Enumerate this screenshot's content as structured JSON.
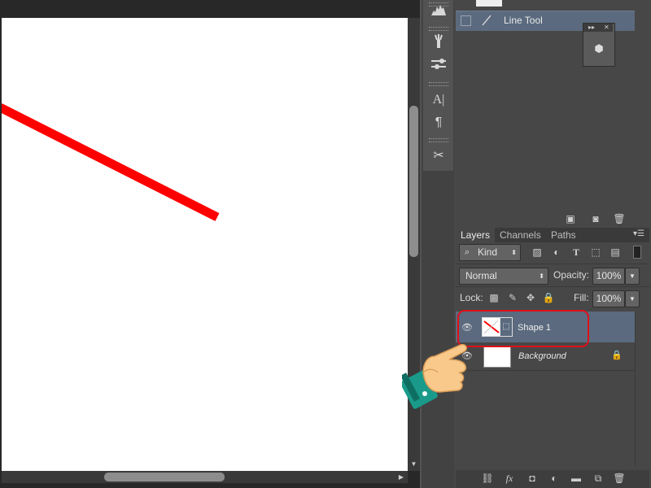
{
  "history": {
    "item_label": "Line Tool"
  },
  "layers_panel": {
    "tabs": [
      "Layers",
      "Channels",
      "Paths"
    ],
    "filter": {
      "kind_label": "Kind"
    },
    "blend_mode": "Normal",
    "opacity_label": "Opacity:",
    "opacity_value": "100%",
    "lock_label": "Lock:",
    "fill_label": "Fill:",
    "fill_value": "100%",
    "layers": [
      {
        "name": "Shape 1",
        "selected": true
      },
      {
        "name": "Background",
        "selected": false,
        "locked": true
      }
    ]
  },
  "colors": {
    "selection_blue": "#5b6a7e",
    "annotation_red": "#e0101a",
    "line_red": "#ff0000"
  },
  "icons": {
    "tools": [
      "histogram-icon",
      "brushes-icon",
      "adjust-icon",
      "character-icon",
      "paragraph-icon",
      "tool-presets-icon"
    ],
    "layers_footer": [
      "link-icon",
      "fx-icon",
      "mask-icon",
      "adjustment-icon",
      "folder-icon",
      "new-layer-icon",
      "trash-icon"
    ]
  }
}
